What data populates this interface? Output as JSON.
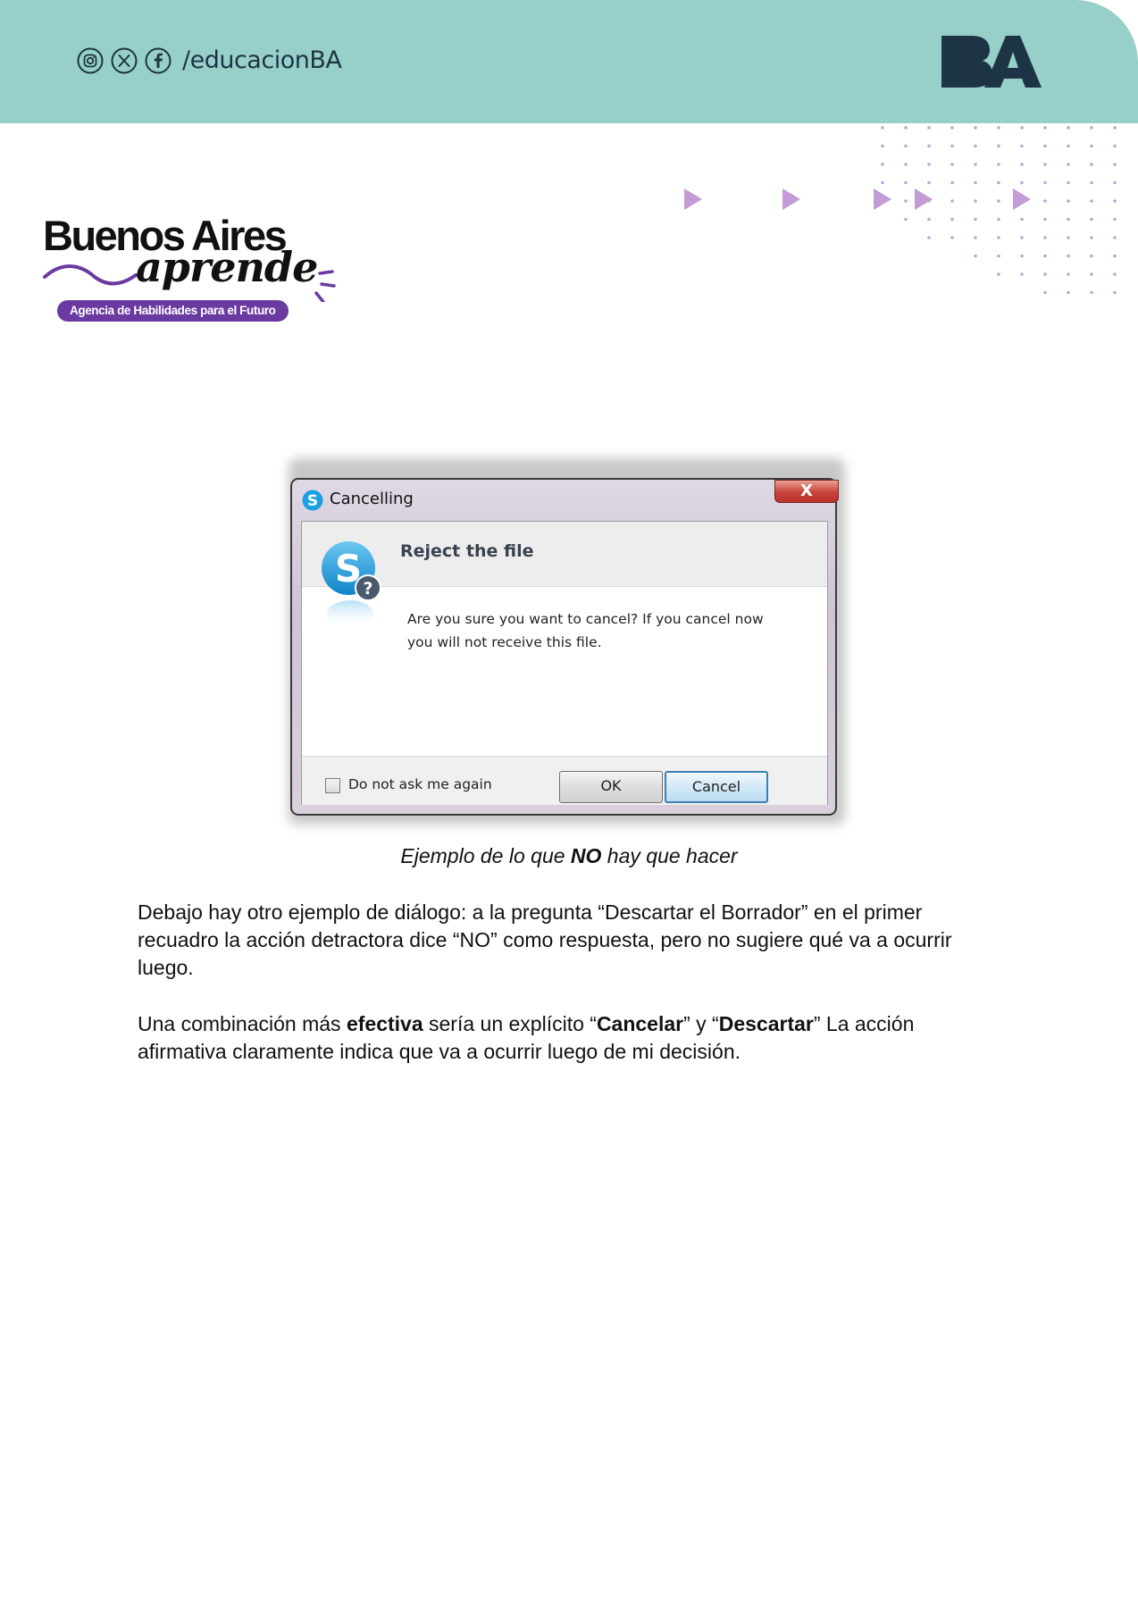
{
  "header": {
    "social_handle": "/educacionBA",
    "social_icons": [
      "instagram-icon",
      "x-icon",
      "facebook-icon"
    ],
    "ba_logo_text": "BA",
    "band_color": "#97d0c9",
    "ink_color": "#1d3444"
  },
  "brand_logo": {
    "title": "Buenos Aires",
    "script": "aprende",
    "tagline": "Agencia de Habilidades para el Futuro",
    "accent_color": "#6a3aa1"
  },
  "dialog": {
    "window_title": "Cancelling",
    "close_symbol": "X",
    "heading": "Reject the file",
    "message": "Are you sure you want to cancel? If you cancel now you will not receive this file.",
    "checkbox_label": "Do not ask me again",
    "checkbox_checked": false,
    "ok_label": "OK",
    "cancel_label": "Cancel"
  },
  "caption": {
    "before": "Ejemplo de lo que ",
    "bold": "NO",
    "after": " hay que hacer"
  },
  "paragraph1": "Debajo hay otro ejemplo de diálogo: a la pregunta “Descartar el Borrador” en el primer recuadro la acción detractora dice “NO” como respuesta, pero no sugiere qué va a ocurrir luego.",
  "paragraph2": {
    "t1": "Una combinación más ",
    "b1": "efectiva",
    "t2": " sería un explícito “",
    "b2": "Cancelar",
    "t3": "” y “",
    "b3": "Descartar",
    "t4": "” La acción afirmativa claramente indica que va a ocurrir luego de mi decisión."
  }
}
